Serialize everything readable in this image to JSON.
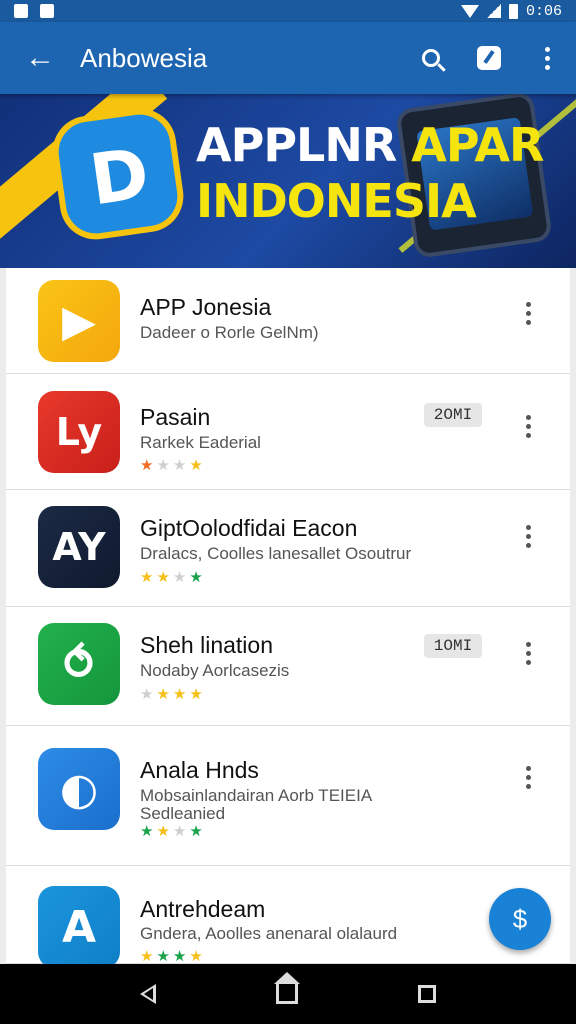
{
  "status_bar": {
    "time": "0:06"
  },
  "app_bar": {
    "title": "Anbowesia"
  },
  "banner": {
    "logo_glyph": "D",
    "line1_white": "APPLNR",
    "line1_yellow": "APAR",
    "line2": "INDONESIA"
  },
  "apps": [
    {
      "name": "APP Jonesia",
      "subtitle": "Dadeer o Rorle GelNm)",
      "icon_text": "▶",
      "icon_colors": [
        "#f9c416",
        "#f4a70c"
      ],
      "badge": "",
      "rating": []
    },
    {
      "name": "Pasain",
      "subtitle": "Rarkek Eaderial",
      "icon_text": "Ly",
      "icon_colors": [
        "#e8392b",
        "#c81f1a"
      ],
      "badge": "2OMI",
      "rating": [
        "#f36a21",
        "#cfcfcf",
        "#cfcfcf",
        "#f5c01a"
      ]
    },
    {
      "name": "GiptOolodfidai Eacon",
      "subtitle": "Dralacs, Coolles lanesallet Osoutrur",
      "icon_text": "AY",
      "icon_colors": [
        "#1c2a45",
        "#0f1a2e"
      ],
      "badge": "",
      "rating": [
        "#f5c01a",
        "#f5c01a",
        "#cfcfcf",
        "#1aa34a"
      ]
    },
    {
      "name": "Sheh lination",
      "subtitle": "Nodaby Aorlcasezis",
      "icon_text": "⥀",
      "icon_colors": [
        "#22b14c",
        "#14963c"
      ],
      "badge": "1OMI",
      "rating": [
        "#cfcfcf",
        "#f5c01a",
        "#f5c01a",
        "#f5c01a"
      ]
    },
    {
      "name": "Anala Hnds",
      "subtitle": "Mobsainlandairan Aorb TEIEIA Sedleanied",
      "icon_text": "◐",
      "icon_colors": [
        "#2d8ce6",
        "#1a6fcc"
      ],
      "badge": "",
      "rating": [
        "#1aa34a",
        "#f5c01a",
        "#cfcfcf",
        "#1aa34a"
      ]
    },
    {
      "name": "Antrehdeam",
      "subtitle": "Gndera, Aoolles anenaral olalaurd",
      "icon_text": "A",
      "icon_colors": [
        "#1b95dd",
        "#0f7fc7"
      ],
      "badge": "",
      "rating": [
        "#f5c01a",
        "#1aa34a",
        "#1aa34a",
        "#f5c01a"
      ]
    }
  ],
  "fab": {
    "glyph": "$"
  },
  "colors": {
    "primary": "#1d65b1",
    "status_bar": "#1a5a9e",
    "accent": "#1a82d6",
    "banner_yellow": "#f6e40f"
  }
}
